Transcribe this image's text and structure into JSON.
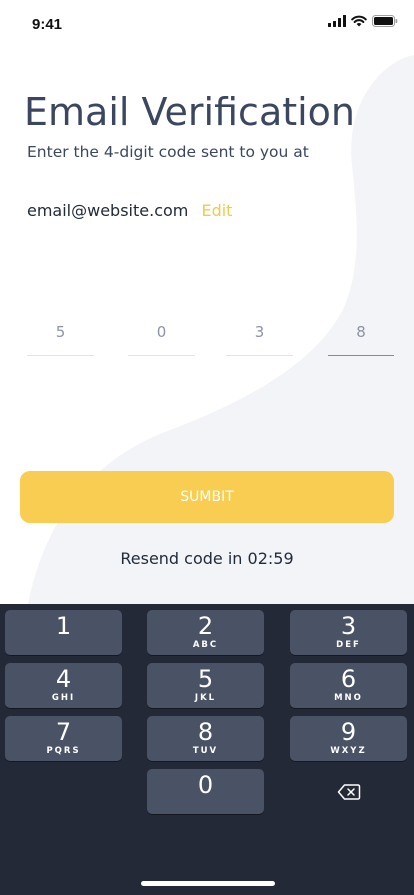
{
  "status_bar": {
    "time": "9:41",
    "icons": [
      "signal-icon",
      "wifi-icon",
      "battery-icon"
    ]
  },
  "screen": {
    "title": "Email Verification",
    "subtitle": "Enter the 4-digit code sent to you at",
    "email": "email@website.com",
    "edit_label": "Edit",
    "code_digits": [
      "5",
      "0",
      "3",
      "8"
    ],
    "active_digit_index": 3,
    "submit_label": "SUMBIT",
    "resend_text": "Resend code in 02:59"
  },
  "keyboard": {
    "keys": [
      {
        "num": "1",
        "letters": ""
      },
      {
        "num": "2",
        "letters": "ABC"
      },
      {
        "num": "3",
        "letters": "DEF"
      },
      {
        "num": "4",
        "letters": "GHI"
      },
      {
        "num": "5",
        "letters": "JKL"
      },
      {
        "num": "6",
        "letters": "MNO"
      },
      {
        "num": "7",
        "letters": "PQRS"
      },
      {
        "num": "8",
        "letters": "TUV"
      },
      {
        "num": "9",
        "letters": "WXYZ"
      },
      {
        "num": "0",
        "letters": ""
      }
    ],
    "delete_icon": "backspace-icon"
  },
  "colors": {
    "title": "#3b4760",
    "accent": "#f8cd52",
    "link": "#f4c84a",
    "active_underline": "#4a9fc4",
    "keyboard_bg": "#242937",
    "key_bg": "#4a5366",
    "background_shape": "#f3f4f8"
  }
}
